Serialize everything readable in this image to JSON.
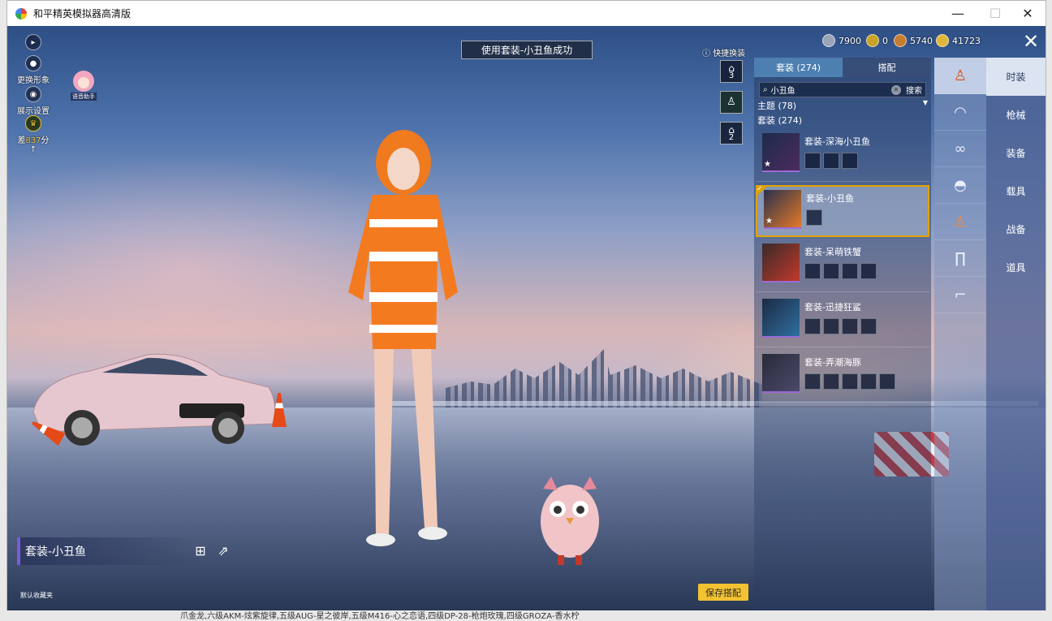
{
  "window": {
    "title": "和平精英模拟器高清版",
    "min": "—",
    "max": "☐",
    "close": "✕"
  },
  "left": {
    "change_look": "更换形象",
    "display_settings": "展示设置",
    "score_prefix": "差",
    "score_value": "837",
    "score_suffix": "分",
    "assistant_label": "语音助手"
  },
  "toast": "使用套装-小丑鱼成功",
  "currency": [
    {
      "icon": "silver-coin-icon",
      "value": "7900",
      "color": "#9aa4b8"
    },
    {
      "icon": "token-icon",
      "value": "0",
      "color": "#c9a227"
    },
    {
      "icon": "bronze-coin-icon",
      "value": "5740",
      "color": "#c77d2e"
    },
    {
      "icon": "gold-coin-icon",
      "value": "41723",
      "color": "#e0b73a"
    }
  ],
  "quick_swap": {
    "label": "快捷换装",
    "slots": [
      "3",
      "",
      "2"
    ]
  },
  "panel": {
    "tabs": [
      "套装 (274)",
      "搭配"
    ],
    "search_value": "小丑鱼",
    "search_button": "搜索",
    "theme": "主题 (78)",
    "suits": "套装 (274)",
    "items": [
      {
        "name": "套装-深海小丑鱼",
        "subs": 3,
        "selected": false
      },
      {
        "name": "套装-小丑鱼",
        "subs": 1,
        "selected": true
      },
      {
        "name": "套装-呆萌铁蟹",
        "subs": 4,
        "selected": false
      },
      {
        "name": "套装-迅捷狂鲨",
        "subs": 4,
        "selected": false
      },
      {
        "name": "套装-弄潮海豚",
        "subs": 5,
        "selected": false
      }
    ]
  },
  "categories": [
    "outfit-icon",
    "hat-icon",
    "glasses-icon",
    "mask-icon",
    "top-icon",
    "pants-icon",
    "shoes-icon"
  ],
  "side_menu": [
    "时装",
    "枪械",
    "装备",
    "载具",
    "战备",
    "道具"
  ],
  "current_outfit": "套装-小丑鱼",
  "default_collection": "默认收藏夹",
  "save_button": "保存搭配",
  "bottom_text": "爪金龙,六级AKM-炫紫旋律,五级AUG-星之彼岸,五级M416-心之恋语,四级DP-28-枪炮玫瑰,四级GROZA-香水柠"
}
